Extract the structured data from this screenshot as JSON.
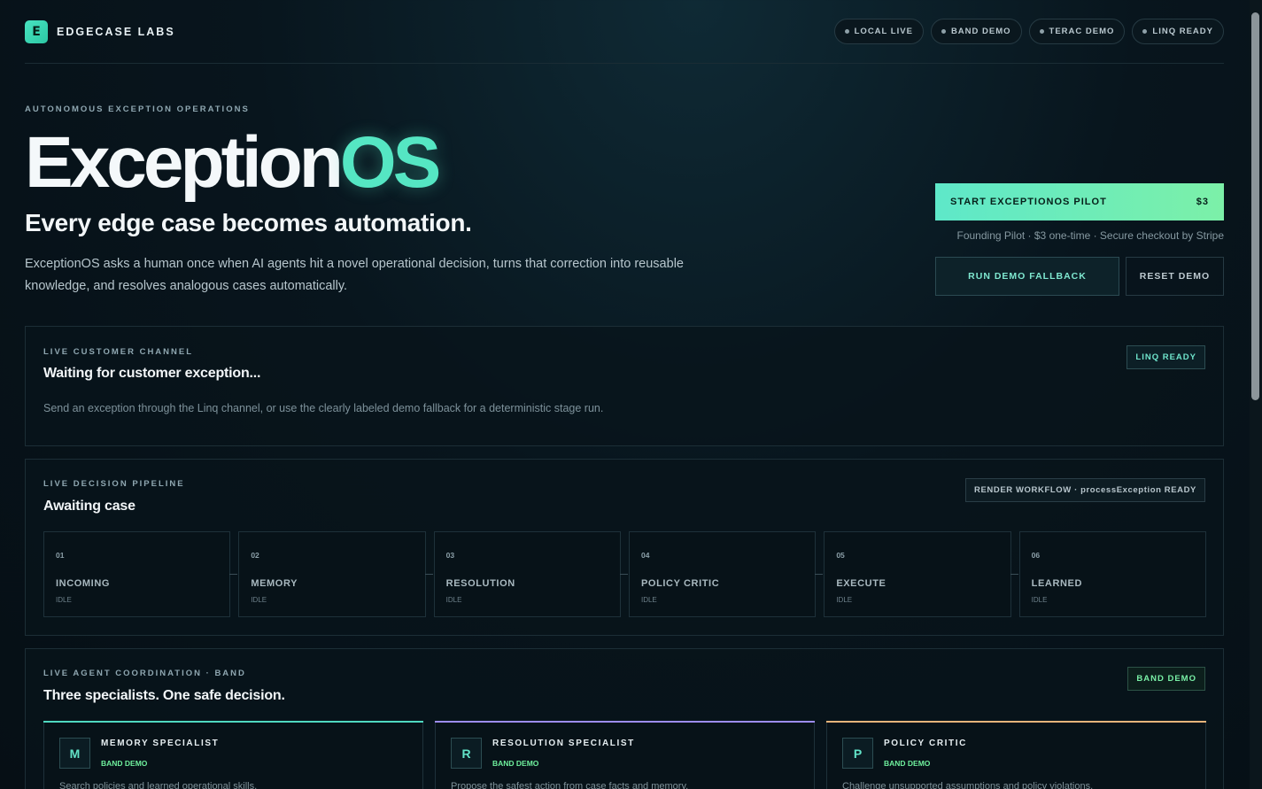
{
  "header": {
    "brand_initial": "E",
    "brand_name": "EDGECASE LABS",
    "pills": [
      "LOCAL LIVE",
      "BAND DEMO",
      "TERAC DEMO",
      "LINQ READY"
    ]
  },
  "hero": {
    "eyebrow": "AUTONOMOUS EXCEPTION OPERATIONS",
    "title_part1": "Exception",
    "title_part2": "OS",
    "subtitle": "Every edge case becomes automation.",
    "description": "ExceptionOS asks a human once when AI agents hit a novel operational decision, turns that correction into reusable knowledge, and resolves analogous cases automatically."
  },
  "cta": {
    "label": "START EXCEPTIONOS PILOT",
    "price": "$3",
    "note": "Founding Pilot · $3 one-time · Secure checkout by Stripe",
    "demo_label": "RUN DEMO FALLBACK",
    "reset_label": "RESET DEMO"
  },
  "channel": {
    "eyebrow": "LIVE CUSTOMER CHANNEL",
    "title": "Waiting for customer exception...",
    "text": "Send an exception through the Linq channel, or use the clearly labeled demo fallback for a deterministic stage run.",
    "tag": "LINQ READY"
  },
  "pipeline": {
    "eyebrow": "LIVE DECISION PIPELINE",
    "title": "Awaiting case",
    "tag": "RENDER WORKFLOW · processException READY",
    "stages": [
      {
        "num": "01",
        "name": "INCOMING",
        "state": "IDLE"
      },
      {
        "num": "02",
        "name": "MEMORY",
        "state": "IDLE"
      },
      {
        "num": "03",
        "name": "RESOLUTION",
        "state": "IDLE"
      },
      {
        "num": "04",
        "name": "POLICY CRITIC",
        "state": "IDLE"
      },
      {
        "num": "05",
        "name": "EXECUTE",
        "state": "IDLE"
      },
      {
        "num": "06",
        "name": "LEARNED",
        "state": "IDLE"
      }
    ]
  },
  "coordination": {
    "eyebrow": "LIVE AGENT COORDINATION · BAND",
    "title": "Three specialists. One safe decision.",
    "tag": "BAND DEMO",
    "specialists": [
      {
        "initial": "M",
        "name": "MEMORY SPECIALIST",
        "badge": "BAND DEMO",
        "desc": "Search policies and learned operational skills.",
        "accent": "#4fd8c0"
      },
      {
        "initial": "R",
        "name": "RESOLUTION SPECIALIST",
        "badge": "BAND DEMO",
        "desc": "Propose the safest action from case facts and memory.",
        "accent": "#9c8cf0"
      },
      {
        "initial": "P",
        "name": "POLICY CRITIC",
        "badge": "BAND DEMO",
        "desc": "Challenge unsupported assumptions and policy violations.",
        "accent": "#e6b47a"
      }
    ]
  }
}
